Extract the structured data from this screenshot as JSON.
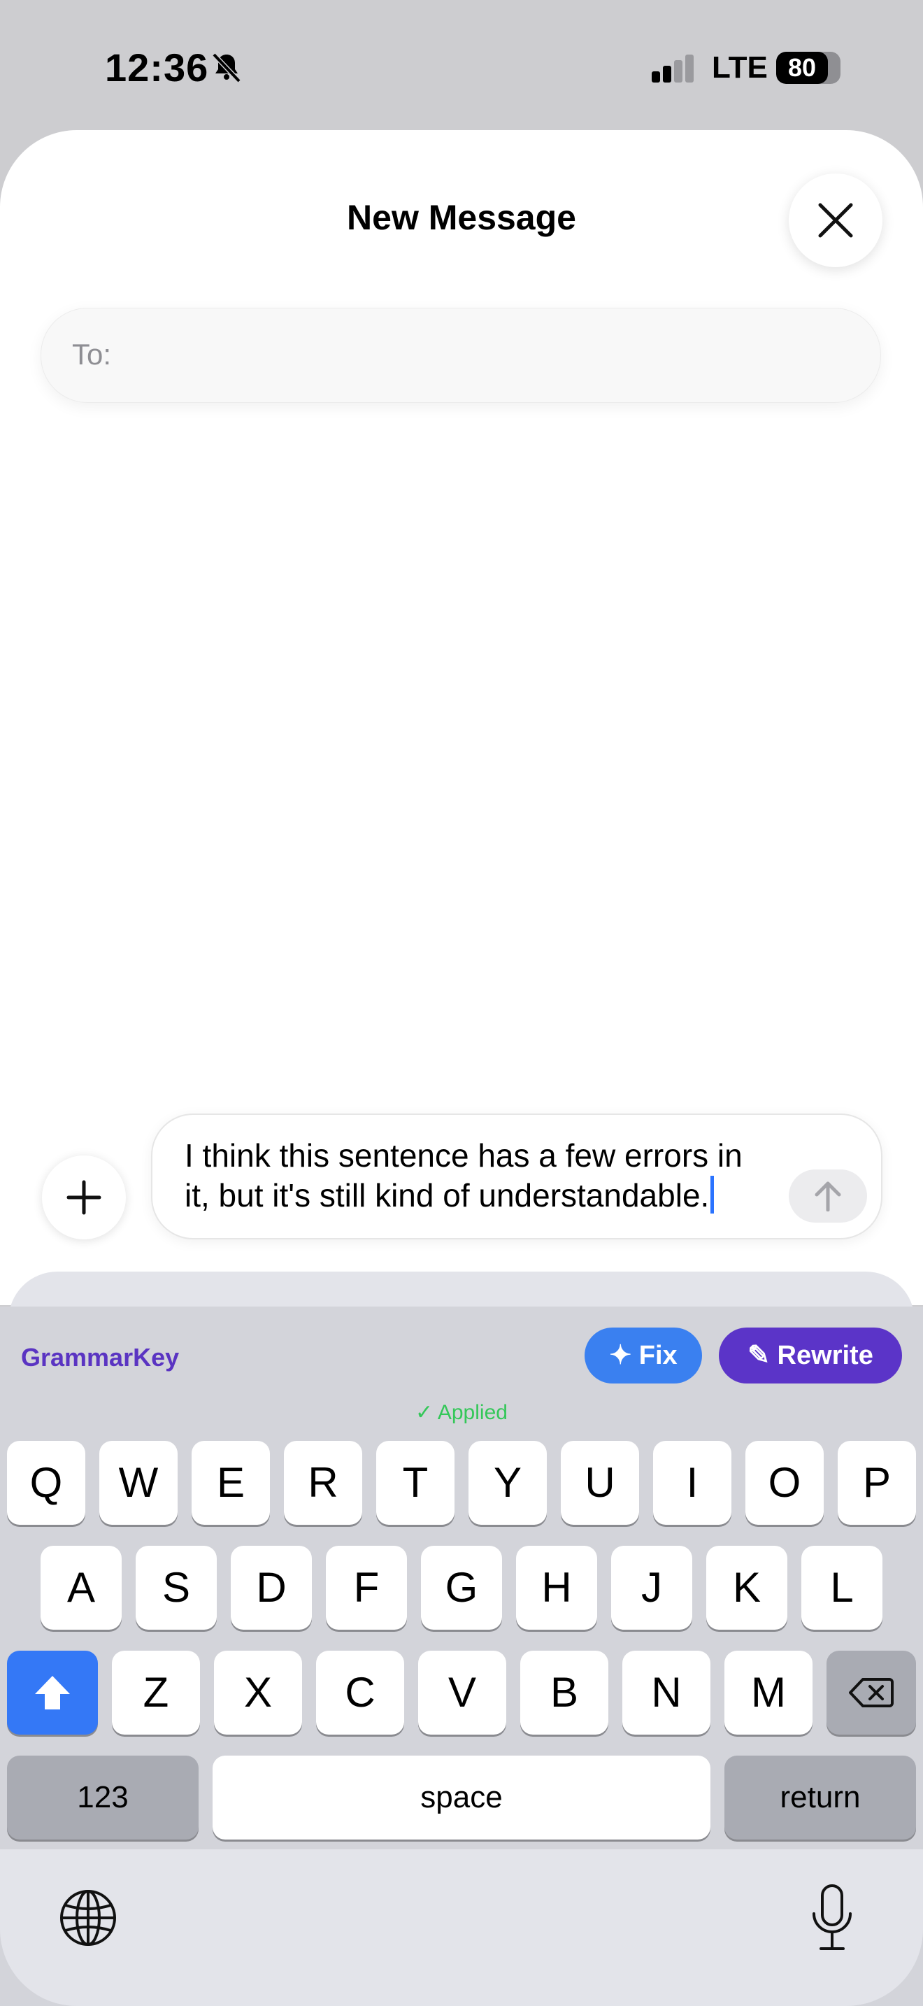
{
  "status_bar": {
    "time": "12:36",
    "network": "LTE",
    "battery_level": "80",
    "battery_fraction": 0.8
  },
  "sheet": {
    "title": "New Message",
    "to_label": "To:"
  },
  "compose": {
    "message_text": "I think this sentence has a few errors in it, but it's still kind of understandable."
  },
  "keyboard_toolbar": {
    "brand": "GrammarKey",
    "fix_label": "✦ Fix",
    "rewrite_label": "✎ Rewrite",
    "status": "✓ Applied"
  },
  "keys": {
    "row1": [
      "Q",
      "W",
      "E",
      "R",
      "T",
      "Y",
      "U",
      "I",
      "O",
      "P"
    ],
    "row2": [
      "A",
      "S",
      "D",
      "F",
      "G",
      "H",
      "J",
      "K",
      "L"
    ],
    "row3": [
      "Z",
      "X",
      "C",
      "V",
      "B",
      "N",
      "M"
    ],
    "numbers": "123",
    "space": "space",
    "return": "return"
  },
  "colors": {
    "accent_blue": "#3a80f0",
    "brand_purple": "#5b34c8",
    "applied_green": "#34c759"
  }
}
